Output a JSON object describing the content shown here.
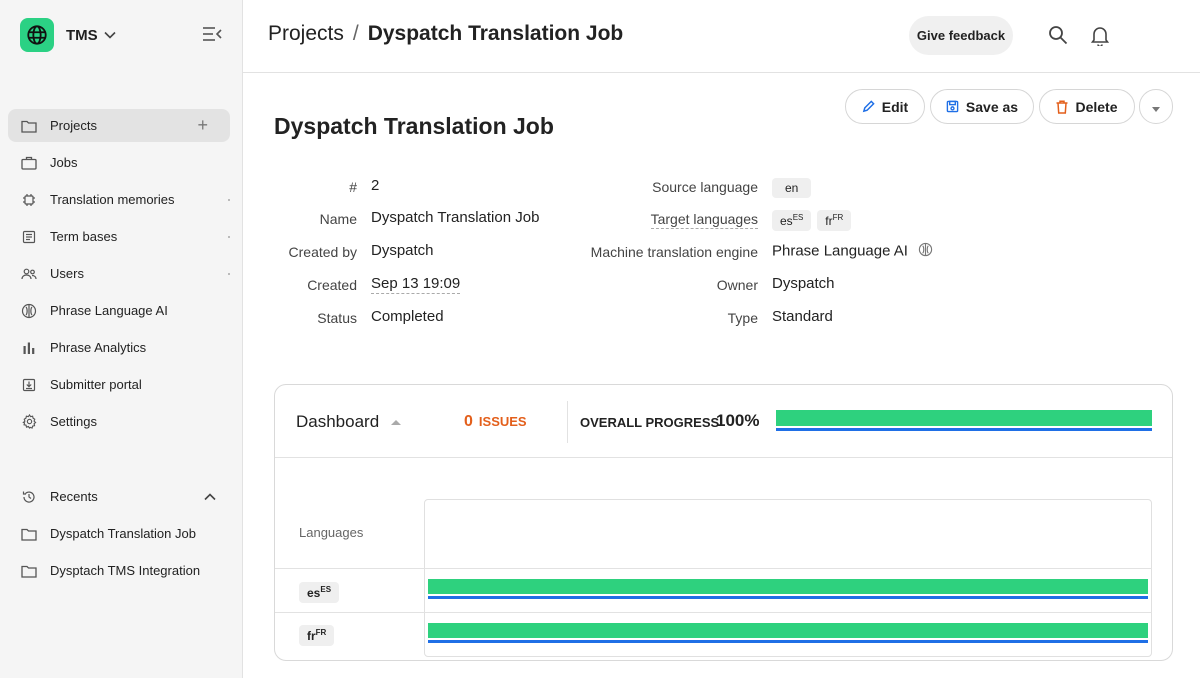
{
  "app": {
    "name": "TMS"
  },
  "sidebar": {
    "items": [
      {
        "label": "Projects"
      },
      {
        "label": "Jobs"
      },
      {
        "label": "Translation memories"
      },
      {
        "label": "Term bases"
      },
      {
        "label": "Users"
      },
      {
        "label": "Phrase Language AI"
      },
      {
        "label": "Phrase Analytics"
      },
      {
        "label": "Submitter portal"
      },
      {
        "label": "Settings"
      }
    ],
    "add_symbol": "+",
    "recents_label": "Recents",
    "recents": [
      {
        "label": "Dyspatch Translation Job"
      },
      {
        "label": "Dysptach TMS Integration"
      }
    ]
  },
  "header": {
    "breadcrumb_root": "Projects",
    "breadcrumb_sep": "/",
    "breadcrumb_current": "Dyspatch Translation Job",
    "feedback_label": "Give feedback"
  },
  "actions": {
    "edit": "Edit",
    "save_as": "Save as",
    "delete": "Delete"
  },
  "project": {
    "title": "Dyspatch Translation Job",
    "fields": {
      "number_label": "#",
      "number": "2",
      "name_label": "Name",
      "name": "Dyspatch Translation Job",
      "created_by_label": "Created by",
      "created_by": "Dyspatch",
      "created_label": "Created",
      "created": "Sep 13 19:09",
      "status_label": "Status",
      "status": "Completed",
      "source_lang_label": "Source language",
      "source_lang": "en",
      "target_langs_label": "Target languages",
      "target_langs": [
        {
          "code": "es",
          "sub": "ES"
        },
        {
          "code": "fr",
          "sub": "FR"
        }
      ],
      "mt_label": "Machine translation engine",
      "mt": "Phrase Language AI",
      "owner_label": "Owner",
      "owner": "Dyspatch",
      "type_label": "Type",
      "type": "Standard"
    }
  },
  "dashboard": {
    "title": "Dashboard",
    "issues_count": "0",
    "issues_label": "ISSUES",
    "overall_label": "OVERALL PROGRESS",
    "overall_value": "100%",
    "overall_progress": 1.0,
    "languages_label": "Languages",
    "rows": [
      {
        "code": "es",
        "sub": "ES",
        "progress": 1.0
      },
      {
        "code": "fr",
        "sub": "FR",
        "progress": 1.0
      }
    ]
  },
  "colors": {
    "accent": "#2bd184",
    "progress": "#2ed17e",
    "progress_line": "#1f6fe6",
    "issues": "#e35f1b"
  }
}
